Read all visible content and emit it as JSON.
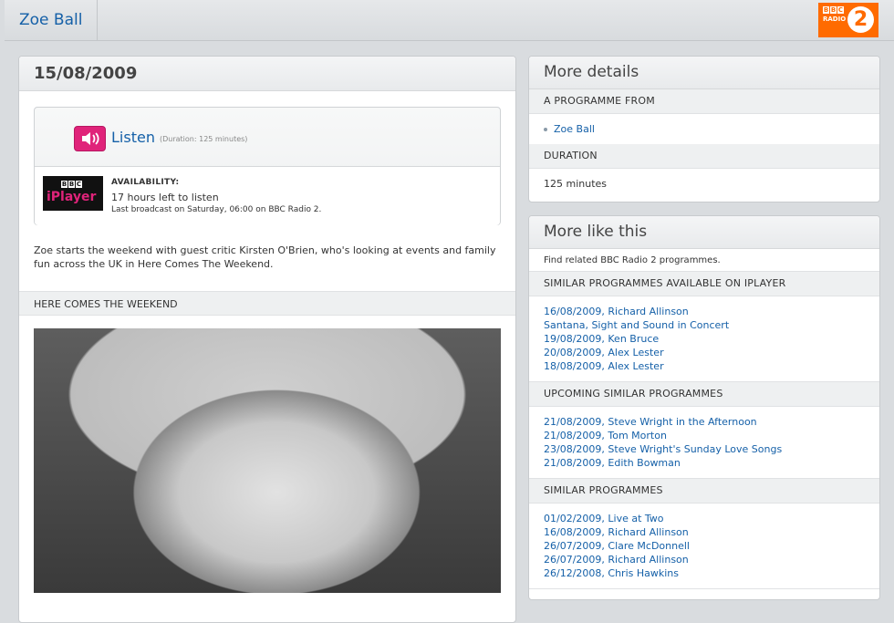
{
  "header": {
    "brand_name": "Zoe Ball",
    "station_logo": {
      "bbc_letters": [
        "B",
        "B",
        "C"
      ],
      "radio": "RADIO",
      "number": "2",
      "color": "#ff6b00"
    }
  },
  "episode": {
    "date": "15/08/2009",
    "listen_label": "Listen",
    "listen_duration": "(Duration: 125 minutes)",
    "listen_icon": "speaker-icon",
    "listen_color": "#e0237a",
    "iplayer_logo": {
      "bbc_letters": [
        "B",
        "B",
        "C"
      ],
      "text": "iPlayer"
    },
    "availability_label": "AVAILABILITY:",
    "availability_time": "17 hours left to listen",
    "last_broadcast": "Last broadcast on Saturday, 06:00 on BBC Radio 2.",
    "summary": "Zoe starts the weekend with guest critic Kirsten O'Brien, who's looking at events and family fun across the UK in Here Comes The Weekend.",
    "segment_title": "HERE COMES THE WEEKEND"
  },
  "more_details": {
    "title": "More details",
    "programme_label": "A PROGRAMME FROM",
    "programme_link": "Zoe Ball",
    "duration_label": "DURATION",
    "duration_value": "125 minutes"
  },
  "more_like_this": {
    "title": "More like this",
    "intro": "Find related BBC Radio 2 programmes.",
    "sections": [
      {
        "label": "SIMILAR PROGRAMMES AVAILABLE ON IPLAYER",
        "items": [
          "16/08/2009, Richard Allinson",
          "Santana, Sight and Sound in Concert",
          "19/08/2009, Ken Bruce",
          "20/08/2009, Alex Lester",
          "18/08/2009, Alex Lester"
        ]
      },
      {
        "label": "UPCOMING SIMILAR PROGRAMMES",
        "items": [
          "21/08/2009, Steve Wright in the Afternoon",
          "21/08/2009, Tom Morton",
          "23/08/2009, Steve Wright's Sunday Love Songs",
          "21/08/2009, Edith Bowman"
        ]
      },
      {
        "label": "SIMILAR PROGRAMMES",
        "items": [
          "01/02/2009, Live at Two",
          "16/08/2009, Richard Allinson",
          "26/07/2009, Clare McDonnell",
          "26/07/2009, Richard Allinson",
          "26/12/2008, Chris Hawkins"
        ]
      }
    ]
  }
}
